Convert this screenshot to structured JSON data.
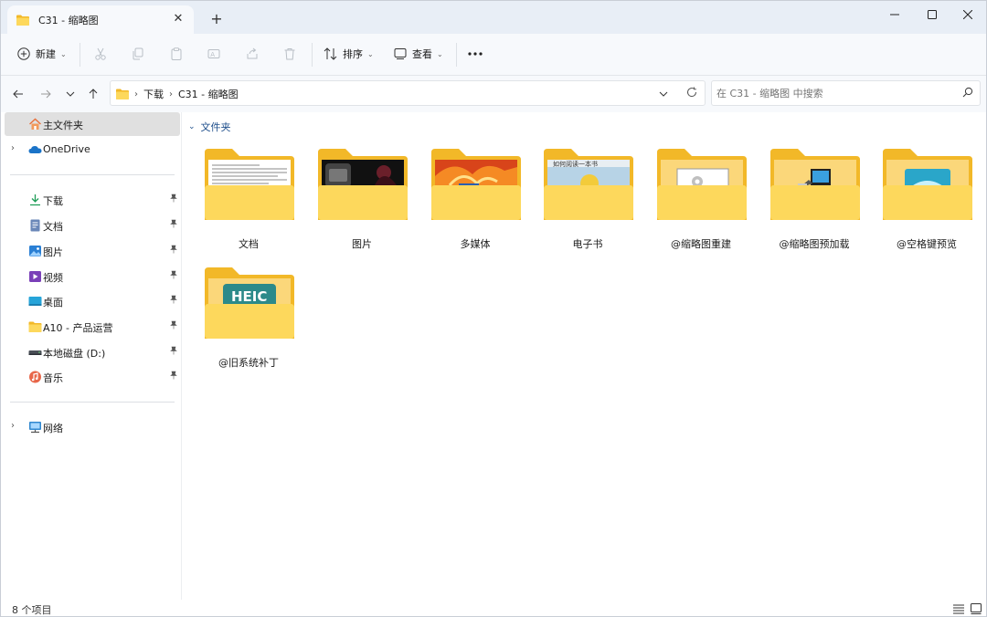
{
  "tab": {
    "title": "C31 - 缩略图"
  },
  "toolbar": {
    "new_label": "新建",
    "sort_label": "排序",
    "view_label": "查看"
  },
  "address": {
    "crumbs": [
      "下载",
      "C31 - 缩略图"
    ]
  },
  "search": {
    "placeholder": "在 C31 - 缩略图 中搜索"
  },
  "sidebar": {
    "home": "主文件夹",
    "onedrive": "OneDrive",
    "quick": [
      "下载",
      "文档",
      "图片",
      "视频",
      "桌面",
      "A10 - 产品运营",
      "本地磁盘 (D:)",
      "音乐"
    ],
    "network": "网络"
  },
  "content": {
    "group_label": "文件夹",
    "folders": [
      "文档",
      "图片",
      "多媒体",
      "电子书",
      "@缩略图重建",
      "@缩略图预加载",
      "@空格键预览",
      "@旧系统补丁"
    ],
    "heic_text": "HEIC",
    "ebook_text": "如何阅读一本书"
  },
  "status": {
    "count": "8 个项目"
  },
  "colors": {
    "folder_back": "#f2b828",
    "folder_front": "#fdd85c",
    "accent": "#0067c0"
  }
}
